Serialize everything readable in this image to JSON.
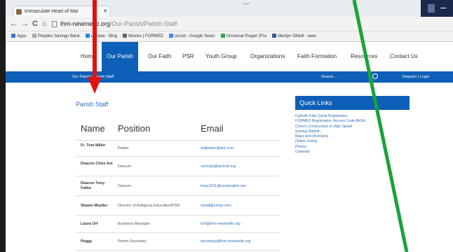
{
  "browser": {
    "tab_title": "Immaculate Heart of Mar",
    "tab_close": "✕",
    "back_glyph": "←",
    "forward_glyph": "→",
    "reload_glyph": "C",
    "home_glyph": "⌂",
    "url_host": "ihm-newmelle.org",
    "url_path": "/Our-Parish/Parish-Staff",
    "bookmarks": [
      {
        "label": "Apps",
        "color": "#3b73c9"
      },
      {
        "label": "Peoples Savings Bank",
        "color": "#aaaaaa"
      },
      {
        "label": "urbotax - Bing",
        "color": "#1e88e5"
      },
      {
        "label": "Movies | FORMED",
        "color": "#666666"
      },
      {
        "label": "uscsb - Google Searc",
        "color": "#4285f4"
      },
      {
        "label": "Universal Prayer (Pra",
        "color": "#2aa84a"
      },
      {
        "label": "Marilyn ONeill - wwo",
        "color": "#3b5998"
      }
    ]
  },
  "nav": {
    "items": [
      "Home",
      "Our Parish",
      "Our Faith",
      "PSR",
      "Youth Group",
      "Organizations",
      "Faith Formation",
      "Resources",
      "Contact Us"
    ],
    "active": "Our Parish"
  },
  "subnav": {
    "breadcrumb": "Our Parish  /  Parish Staff",
    "search_label": "Search...",
    "register_login": "Register  |  Login"
  },
  "page": {
    "title": "Parish Staff"
  },
  "staff_table": {
    "headers": [
      "Name",
      "Position",
      "Email"
    ],
    "rows": [
      {
        "name": "Fr. Tom Miller",
        "position": "Pastor",
        "email": "asilpadre@aol.com"
      },
      {
        "name": "Deacon Chris Ast",
        "position": "Deacon",
        "email": "chricast@archstl.org"
      },
      {
        "name": "Deacon Tony Fatbo",
        "position": "Deacon",
        "email": "tony.2011@centurylink.net"
      },
      {
        "name": "Shawn Mueller",
        "position": "Director of Religious Education/PSR",
        "email": "email@email.com"
      },
      {
        "name": "Laura Orf",
        "position": "Business Manager",
        "email": "lorf@ihm-newmelle.org"
      },
      {
        "name": "Peggy",
        "position": "Parish Secretary",
        "email": "secretary@ihm-newmelle.org"
      }
    ]
  },
  "quick_links": {
    "title": "Quick Links",
    "items": [
      "Catholic Kids Camp Registration",
      "FORMED Registration: Access Code-8b2dc",
      "Church Construction in High Speed",
      "Sunday Bulletin",
      "Maps and Directions",
      "Online Giving",
      "Photos",
      "Calendar"
    ]
  },
  "annotations": {
    "red_arrow_color": "#e11111",
    "green_arrow_color": "#1aa33a"
  }
}
